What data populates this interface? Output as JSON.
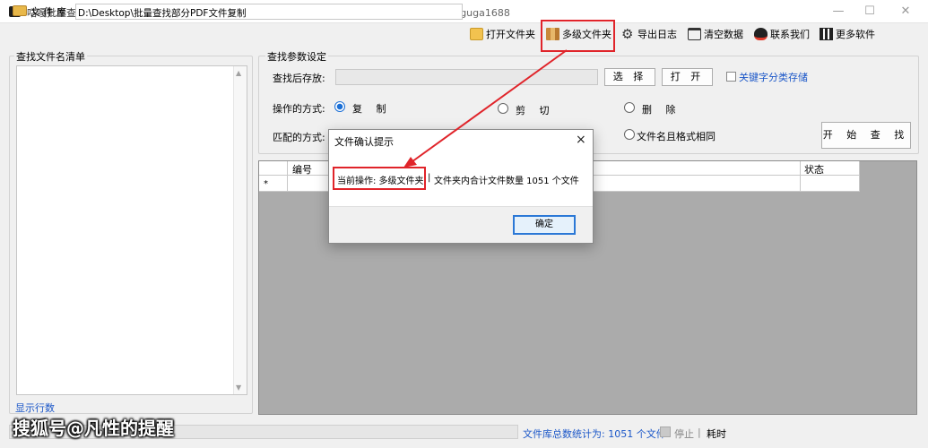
{
  "window": {
    "title": "咕嘎批量查找文件移动存储系统  正式版",
    "service": "客服微信: guga1688"
  },
  "toolbar": {
    "library_label": "文 件 库",
    "library_path": "D:\\Desktop\\批量查找部分PDF文件复制",
    "open_folder": "打开文件夹",
    "multi_folder": "多级文件夹",
    "export_log": "导出日志",
    "clear_data": "清空数据",
    "contact": "联系我们",
    "more_software": "更多软件"
  },
  "left": {
    "legend": "查找文件名清单",
    "show_rows": "显示行数"
  },
  "params": {
    "legend": "查找参数设定",
    "save_label": "查找后存放:",
    "select_btn": "选 择",
    "open_btn": "打 开",
    "keyword_label": "关键字分类存储",
    "op_label": "操作的方式:",
    "op_copy": "复 制",
    "op_cut": "剪 切",
    "op_delete": "删 除",
    "match_label": "匹配的方式:",
    "match_same": "文件名且格式相同",
    "start_btn": "开 始 查 找"
  },
  "grid": {
    "col_num": "编号",
    "col_status": "状态",
    "new_row_marker": "*"
  },
  "dialog": {
    "title": "文件确认提示",
    "current_op": "当前操作: 多级文件夹",
    "separator": "|",
    "message": "文件夹内合计文件数量 1051 个文件",
    "ok": "确定",
    "close": "×"
  },
  "status": {
    "count": "文件库总数统计为: 1051 个文件",
    "stop": "停止",
    "sep": "|",
    "elapsed": "耗时"
  },
  "watermark": "搜狐号@凡性的提醒",
  "colors": {
    "highlight": "#e0242a",
    "link": "#1a56c8",
    "grid_bg": "#ababab"
  }
}
